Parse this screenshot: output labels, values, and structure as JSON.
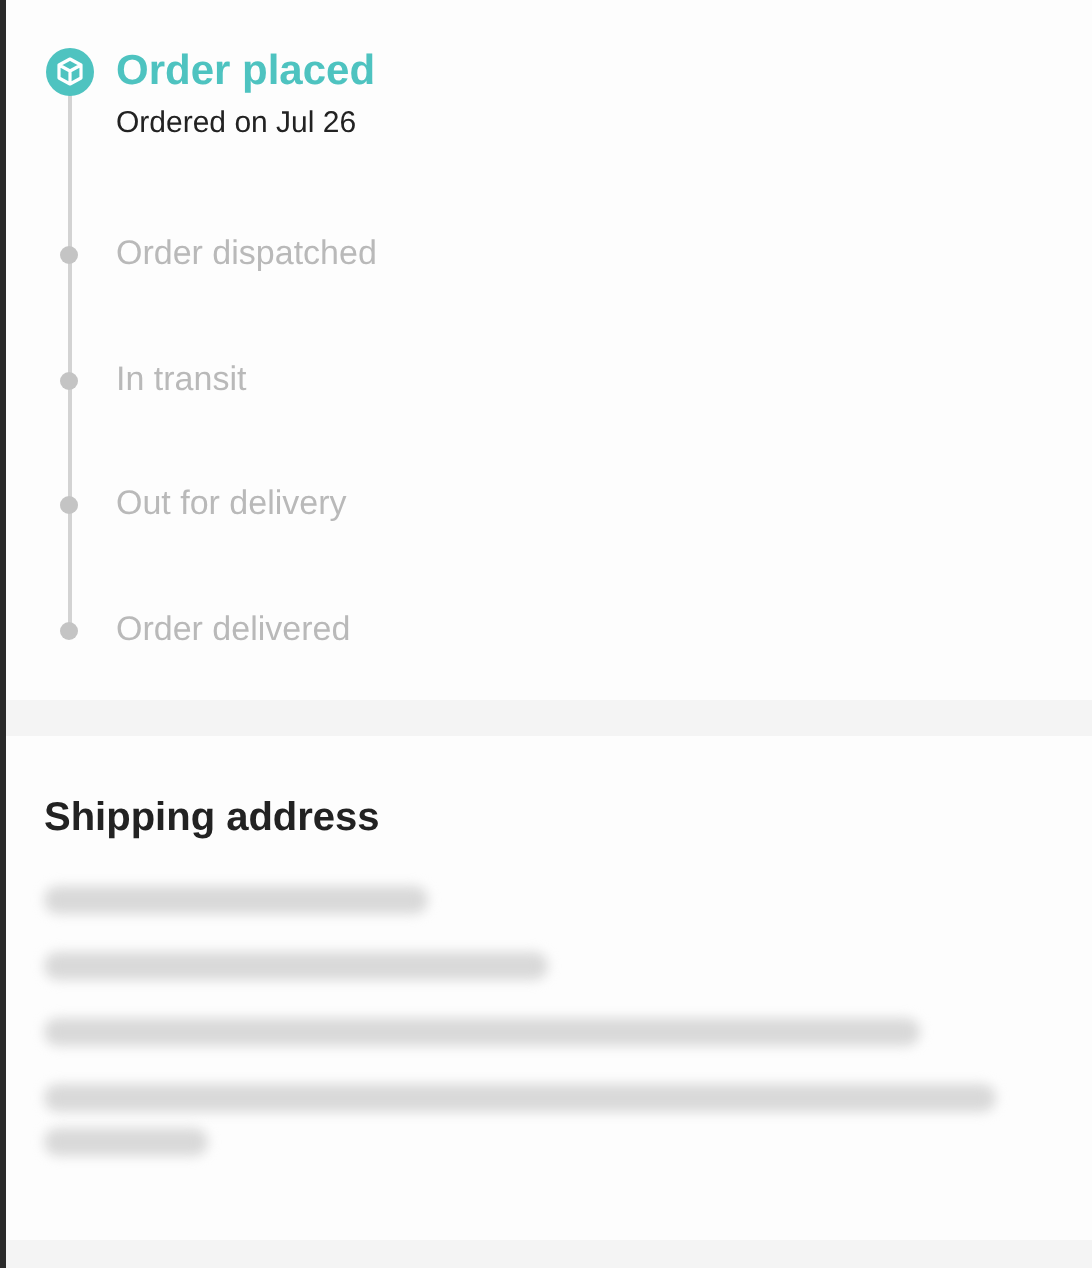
{
  "tracking": {
    "steps": [
      {
        "label": "Order placed",
        "detail": "Ordered on Jul 26",
        "completed": true
      },
      {
        "label": "Order dispatched",
        "completed": false
      },
      {
        "label": "In transit",
        "completed": false
      },
      {
        "label": "Out for delivery",
        "completed": false
      },
      {
        "label": "Order delivered",
        "completed": false
      }
    ]
  },
  "shipping": {
    "title": "Shipping address"
  }
}
